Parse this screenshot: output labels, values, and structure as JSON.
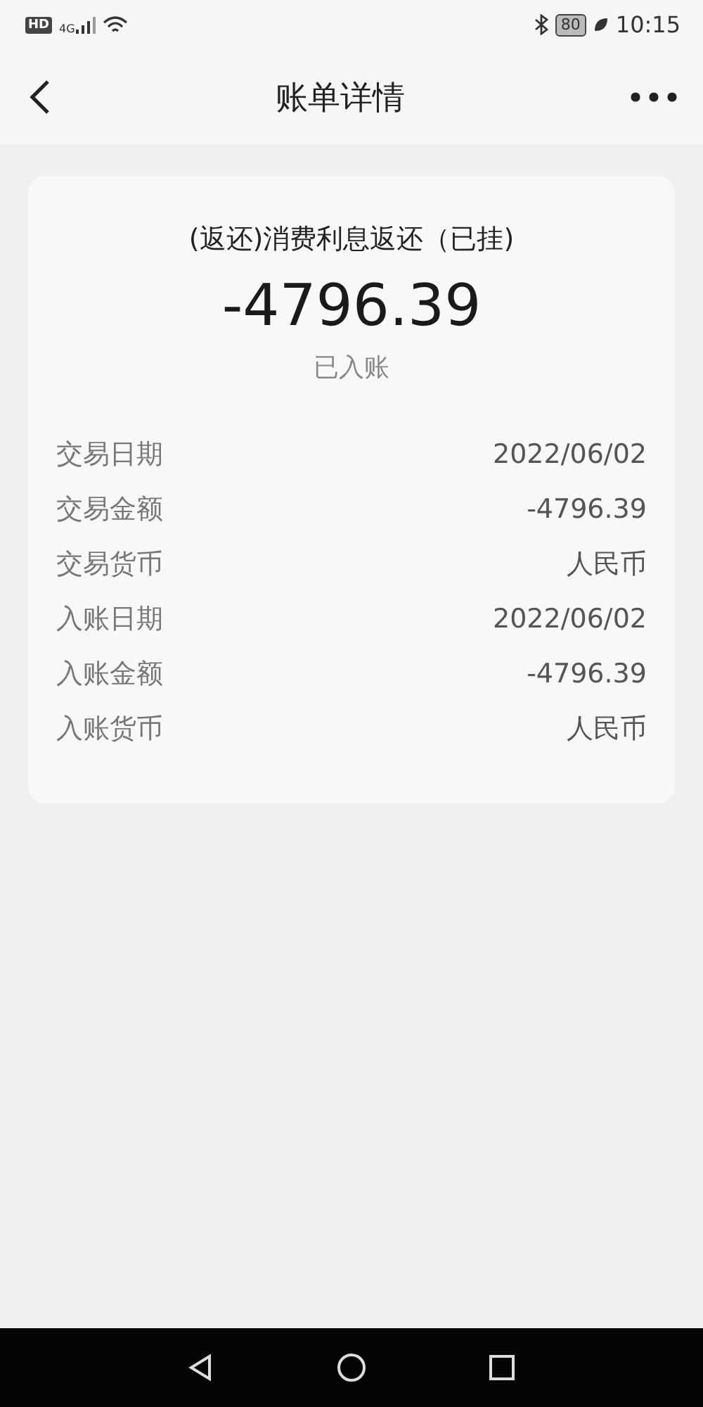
{
  "status_bar": {
    "hd": "HD",
    "network": "4G",
    "battery": "80",
    "time": "10:15"
  },
  "nav": {
    "title": "账单详情"
  },
  "bill": {
    "title": "(返还)消费利息返还（已挂)",
    "amount": "-4796.39",
    "status": "已入账",
    "rows": [
      {
        "label": "交易日期",
        "value": "2022/06/02"
      },
      {
        "label": "交易金额",
        "value": "-4796.39"
      },
      {
        "label": "交易货币",
        "value": "人民币"
      },
      {
        "label": "入账日期",
        "value": "2022/06/02"
      },
      {
        "label": "入账金额",
        "value": "-4796.39"
      },
      {
        "label": "入账货币",
        "value": "人民币"
      }
    ]
  }
}
